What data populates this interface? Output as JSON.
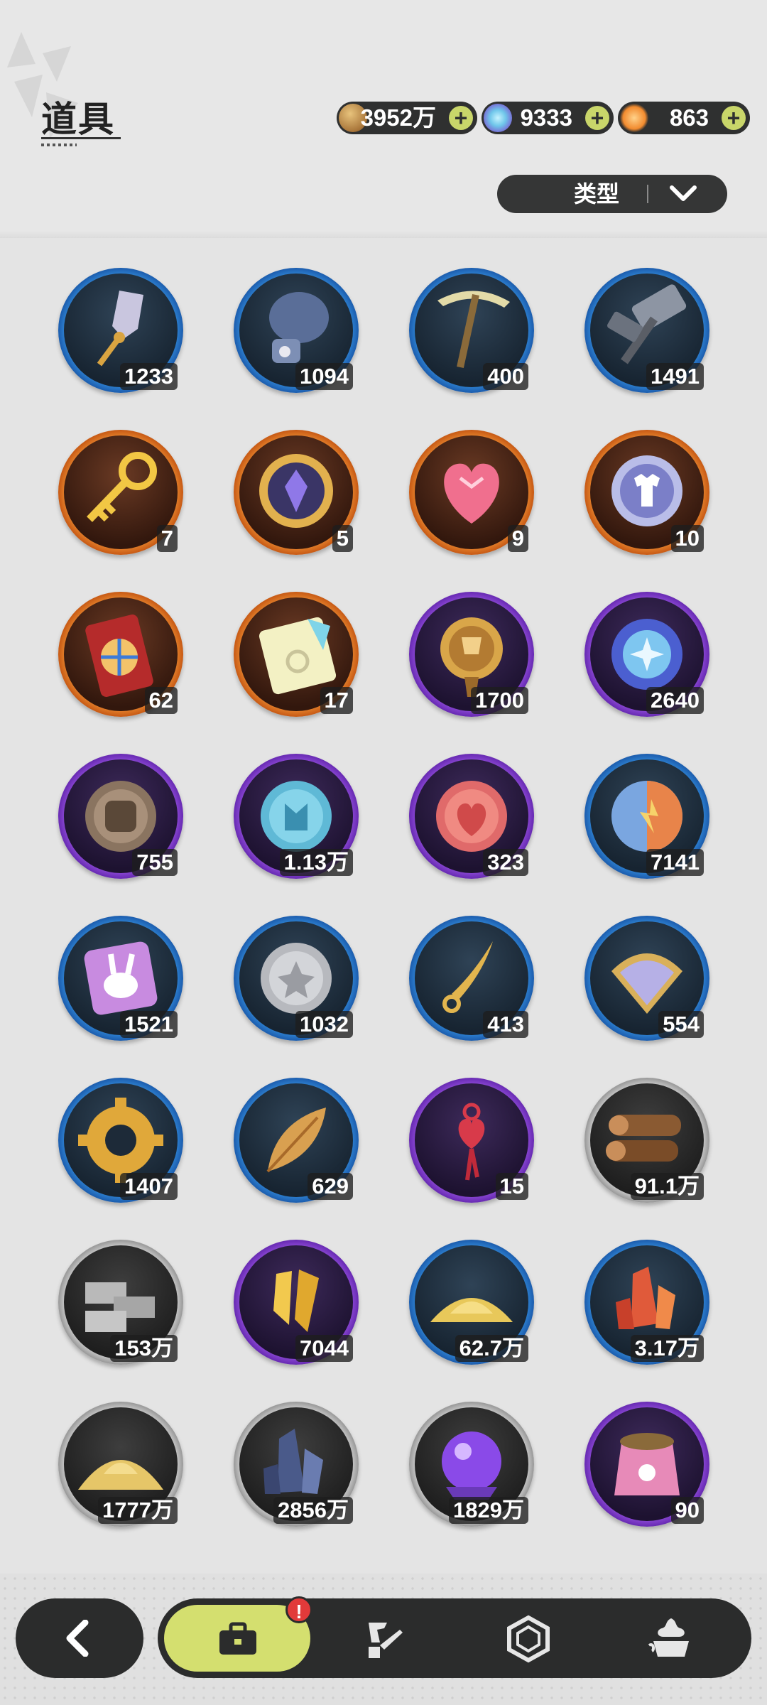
{
  "header": {
    "title": "道具"
  },
  "currencies": [
    {
      "icon": "coin-icon",
      "value": "3952万",
      "add": "+"
    },
    {
      "icon": "crystal-icon",
      "value": "9333",
      "add": "+"
    },
    {
      "icon": "star-icon",
      "value": "863",
      "add": "+"
    }
  ],
  "filter": {
    "label": "类型",
    "icon": "chevron-down-icon"
  },
  "items": [
    {
      "icon": "shovel-icon",
      "count": "1233",
      "rarity": "blue"
    },
    {
      "icon": "boxing-glove-icon",
      "count": "1094",
      "rarity": "blue"
    },
    {
      "icon": "pickaxe-icon",
      "count": "400",
      "rarity": "blue"
    },
    {
      "icon": "hammer-icon",
      "count": "1491",
      "rarity": "blue"
    },
    {
      "icon": "golden-key-icon",
      "count": "7",
      "rarity": "orange"
    },
    {
      "icon": "emblem-icon",
      "count": "5",
      "rarity": "orange"
    },
    {
      "icon": "crystal-heart-icon",
      "count": "9",
      "rarity": "orange"
    },
    {
      "icon": "shirt-coin-icon",
      "count": "10",
      "rarity": "orange"
    },
    {
      "icon": "wheel-ticket-icon",
      "count": "62",
      "rarity": "orange"
    },
    {
      "icon": "rainbow-ticket-icon",
      "count": "17",
      "rarity": "orange"
    },
    {
      "icon": "trophy-medal-icon",
      "count": "1700",
      "rarity": "purple"
    },
    {
      "icon": "star-orb-icon",
      "count": "2640",
      "rarity": "purple"
    },
    {
      "icon": "fist-coin-icon",
      "count": "755",
      "rarity": "purple"
    },
    {
      "icon": "blue-coin-icon",
      "count": "1.13万",
      "rarity": "purple"
    },
    {
      "icon": "heart-coin-icon",
      "count": "323",
      "rarity": "purple"
    },
    {
      "icon": "split-coin-icon",
      "count": "7141",
      "rarity": "blue"
    },
    {
      "icon": "bunny-card-icon",
      "count": "1521",
      "rarity": "blue"
    },
    {
      "icon": "silver-coin-icon",
      "count": "1032",
      "rarity": "blue"
    },
    {
      "icon": "blade-icon",
      "count": "413",
      "rarity": "blue"
    },
    {
      "icon": "scale-shield-icon",
      "count": "554",
      "rarity": "blue"
    },
    {
      "icon": "gear-ring-icon",
      "count": "1407",
      "rarity": "blue"
    },
    {
      "icon": "golden-leaf-icon",
      "count": "629",
      "rarity": "blue"
    },
    {
      "icon": "heart-knot-icon",
      "count": "15",
      "rarity": "purple"
    },
    {
      "icon": "wood-logs-icon",
      "count": "91.1万",
      "rarity": "grey"
    },
    {
      "icon": "stone-bricks-icon",
      "count": "153万",
      "rarity": "grey"
    },
    {
      "icon": "gold-crystal-icon",
      "count": "7044",
      "rarity": "purple"
    },
    {
      "icon": "gold-dust-icon",
      "count": "62.7万",
      "rarity": "blue"
    },
    {
      "icon": "red-crystal-icon",
      "count": "3.17万",
      "rarity": "blue"
    },
    {
      "icon": "sand-pile-icon",
      "count": "1777万",
      "rarity": "grey"
    },
    {
      "icon": "dark-crystal-icon",
      "count": "2856万",
      "rarity": "grey"
    },
    {
      "icon": "purple-orb-icon",
      "count": "1829万",
      "rarity": "grey"
    },
    {
      "icon": "pet-food-bag-icon",
      "count": "90",
      "rarity": "purple"
    }
  ],
  "nav": {
    "back_icon": "back-arrow-icon",
    "tabs": [
      {
        "icon": "bag-icon",
        "active": true,
        "badge": "!"
      },
      {
        "icon": "equipment-icon",
        "active": false
      },
      {
        "icon": "hexagon-gem-icon",
        "active": false
      },
      {
        "icon": "dessert-icon",
        "active": false
      }
    ]
  }
}
